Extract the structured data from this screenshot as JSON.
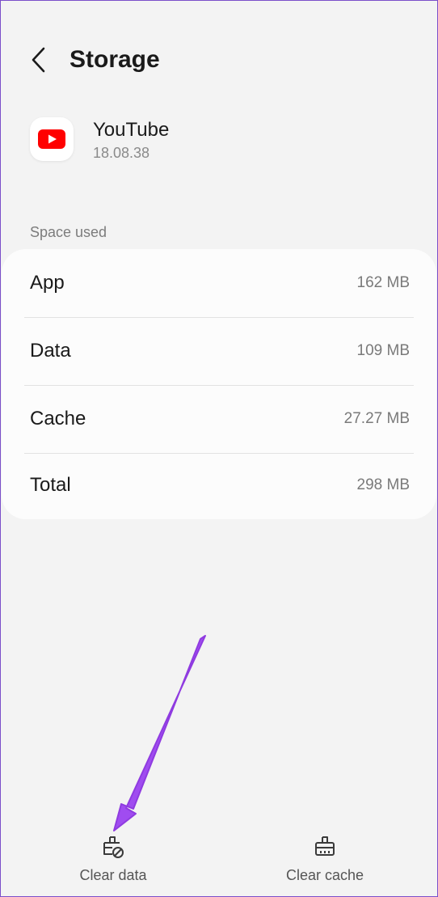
{
  "header": {
    "title": "Storage",
    "back_icon": "chevron-left-icon"
  },
  "app": {
    "name": "YouTube",
    "version": "18.08.38",
    "icon": "youtube-logo-icon",
    "brand_color": "#ff0000"
  },
  "space_used": {
    "label": "Space used",
    "rows": [
      {
        "label": "App",
        "value": "162 MB"
      },
      {
        "label": "Data",
        "value": "109 MB"
      },
      {
        "label": "Cache",
        "value": "27.27 MB"
      },
      {
        "label": "Total",
        "value": "298 MB"
      }
    ]
  },
  "bottom_bar": {
    "clear_data": {
      "label": "Clear data",
      "icon": "clear-data-icon"
    },
    "clear_cache": {
      "label": "Clear cache",
      "icon": "clear-cache-icon"
    }
  },
  "annotation": {
    "color": "#a04cf0"
  }
}
